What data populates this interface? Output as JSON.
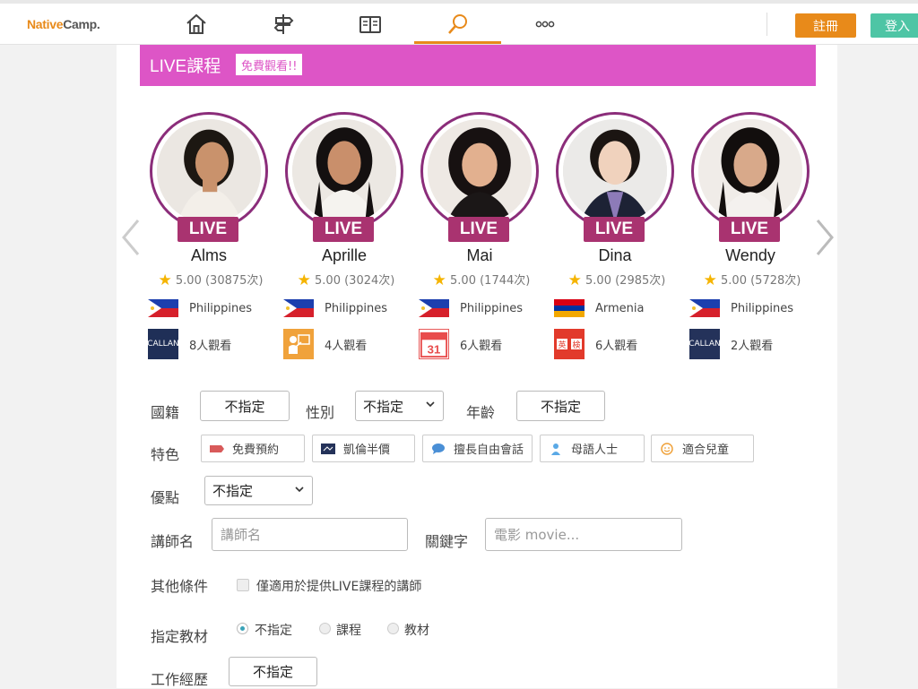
{
  "header": {
    "logo_native": "Native",
    "logo_camp": "Camp.",
    "nav": [
      "home-icon",
      "signpost-icon",
      "book-icon",
      "search-icon",
      "more-icon"
    ],
    "register_label": "註冊",
    "login_label": "登入",
    "colors": {
      "accent": "#e88a1a",
      "login": "#4ec5a5"
    }
  },
  "live_section": {
    "title": "LIVE課程",
    "badge": "免費觀看!!",
    "banner_color": "#dd55c6",
    "live_tag": "LIVE",
    "teachers": [
      {
        "name": "Alms",
        "rating": "5.00 (30875次)",
        "country": "Philippines",
        "viewers": "8人觀看"
      },
      {
        "name": "Aprille",
        "rating": "5.00 (3024次)",
        "country": "Philippines",
        "viewers": "4人觀看"
      },
      {
        "name": "Mai",
        "rating": "5.00 (1744次)",
        "country": "Philippines",
        "viewers": "6人觀看"
      },
      {
        "name": "Dina",
        "rating": "5.00 (2985次)",
        "country": "Armenia",
        "viewers": "6人觀看"
      },
      {
        "name": "Wendy",
        "rating": "5.00 (5728次)",
        "country": "Philippines",
        "viewers": "2人觀看"
      }
    ]
  },
  "filters": {
    "nationality_label": "國籍",
    "nationality_value": "不指定",
    "gender_label": "性別",
    "gender_value": "不指定",
    "age_label": "年齡",
    "age_value": "不指定",
    "features_label": "特色",
    "features": [
      "免費預約",
      "凱倫半價",
      "擅長自由會話",
      "母語人士",
      "適合兒童"
    ],
    "strength_label": "優點",
    "strength_value": "不指定",
    "teacher_name_label": "講師名",
    "teacher_name_placeholder": "講師名",
    "keyword_label": "關鍵字",
    "keyword_placeholder": "電影 movie...",
    "other_label": "其他條件",
    "live_only_label": "僅適用於提供LIVE課程的講師",
    "material_label": "指定教材",
    "material_options": [
      "不指定",
      "課程",
      "教材"
    ],
    "experience_label": "工作經歷",
    "experience_value": "不指定"
  }
}
